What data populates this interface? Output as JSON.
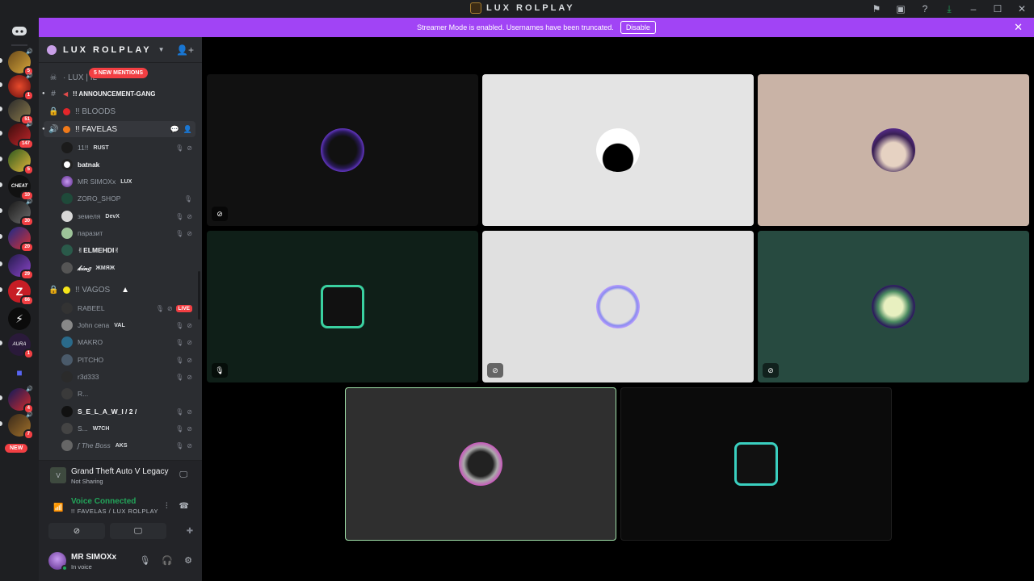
{
  "window": {
    "title": "LUX ROLPLAY"
  },
  "banner": {
    "text": "Streamer Mode is enabled. Usernames have been truncated.",
    "button": "Disable"
  },
  "rail": {
    "servers": [
      {
        "badge": "5"
      },
      {
        "badge": "1"
      },
      {
        "badge": "51"
      },
      {
        "badge": "147"
      },
      {
        "badge": "5"
      },
      {
        "badge": "10",
        "label": "CHEAT"
      },
      {
        "badge": "30"
      },
      {
        "badge": "20"
      },
      {
        "badge": "29"
      },
      {
        "badge": "66"
      },
      {
        "badge": ""
      },
      {
        "badge": "1",
        "label": "AURA"
      },
      {
        "badge": ""
      },
      {
        "badge": "4"
      },
      {
        "badge": "7"
      }
    ],
    "new_label": "NEW"
  },
  "sidebar": {
    "server_name": "LUX ROLPLAY",
    "new_mentions": "5 NEW MENTIONS",
    "channels": [
      {
        "label": "· LUX | IL"
      },
      {
        "label": "!! ANNOUNCEMENT-GANG"
      },
      {
        "label": "!! BLOODS"
      },
      {
        "label": "!! FAVELAS"
      },
      {
        "label": "!! VAGOS"
      }
    ],
    "favelas_users": [
      {
        "name": "11!!",
        "tag": "RUST"
      },
      {
        "name": "batnak",
        "tag": ""
      },
      {
        "name": "MR SIMOXx",
        "tag": "LUX"
      },
      {
        "name": "ZORO_SHOP",
        "tag": ""
      },
      {
        "name": "земеля",
        "tag": "DevX"
      },
      {
        "name": "паразит",
        "tag": ""
      },
      {
        "name": "✌ELMEHDI✌",
        "tag": ""
      },
      {
        "name": "𝓀𝒾𝓃𝑔",
        "tag": "ЖМЯЖ"
      }
    ],
    "vagos_users": [
      {
        "name": "RABEEL",
        "tag": "",
        "live": "LIVE"
      },
      {
        "name": "John cena",
        "tag": "VAL"
      },
      {
        "name": "MAKRO",
        "tag": ""
      },
      {
        "name": "PITCHO",
        "tag": ""
      },
      {
        "name": "r3d333",
        "tag": ""
      },
      {
        "name": "R...",
        "tag": ""
      },
      {
        "name": "S_E_L_A_W_I / 2 /",
        "tag": ""
      },
      {
        "name": "S...",
        "tag": "W7CH"
      },
      {
        "name": "ʃ The Boss",
        "tag": "AKS"
      }
    ]
  },
  "activity": {
    "game": "Grand Theft Auto V Legacy",
    "status": "Not Sharing"
  },
  "voice": {
    "status": "Voice Connected",
    "channel": "!! FAVELAS / LUX ROLPLAY"
  },
  "user": {
    "name": "MR SIMOXx",
    "status": "In voice"
  },
  "colors": {
    "accent": "#5865f2",
    "banner": "#a144f5",
    "online": "#23a55a",
    "danger": "#f23f43"
  }
}
